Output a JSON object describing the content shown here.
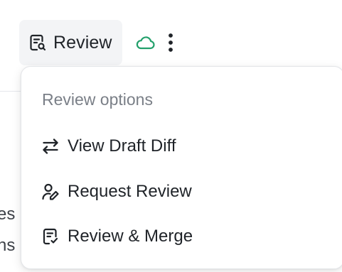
{
  "toolbar": {
    "review_label": "Review",
    "review_icon": "review-document-icon",
    "sync_icon": "cloud-icon",
    "sync_color": "#22a06b",
    "more_icon": "kebab-icon"
  },
  "background": {
    "fragment_1": "es",
    "fragment_2": "ns"
  },
  "menu": {
    "heading": "Review options",
    "items": [
      {
        "label": "View Draft Diff",
        "icon": "swap-arrows-icon"
      },
      {
        "label": "Request Review",
        "icon": "user-edit-icon"
      },
      {
        "label": "Review & Merge",
        "icon": "review-merge-icon"
      }
    ]
  }
}
